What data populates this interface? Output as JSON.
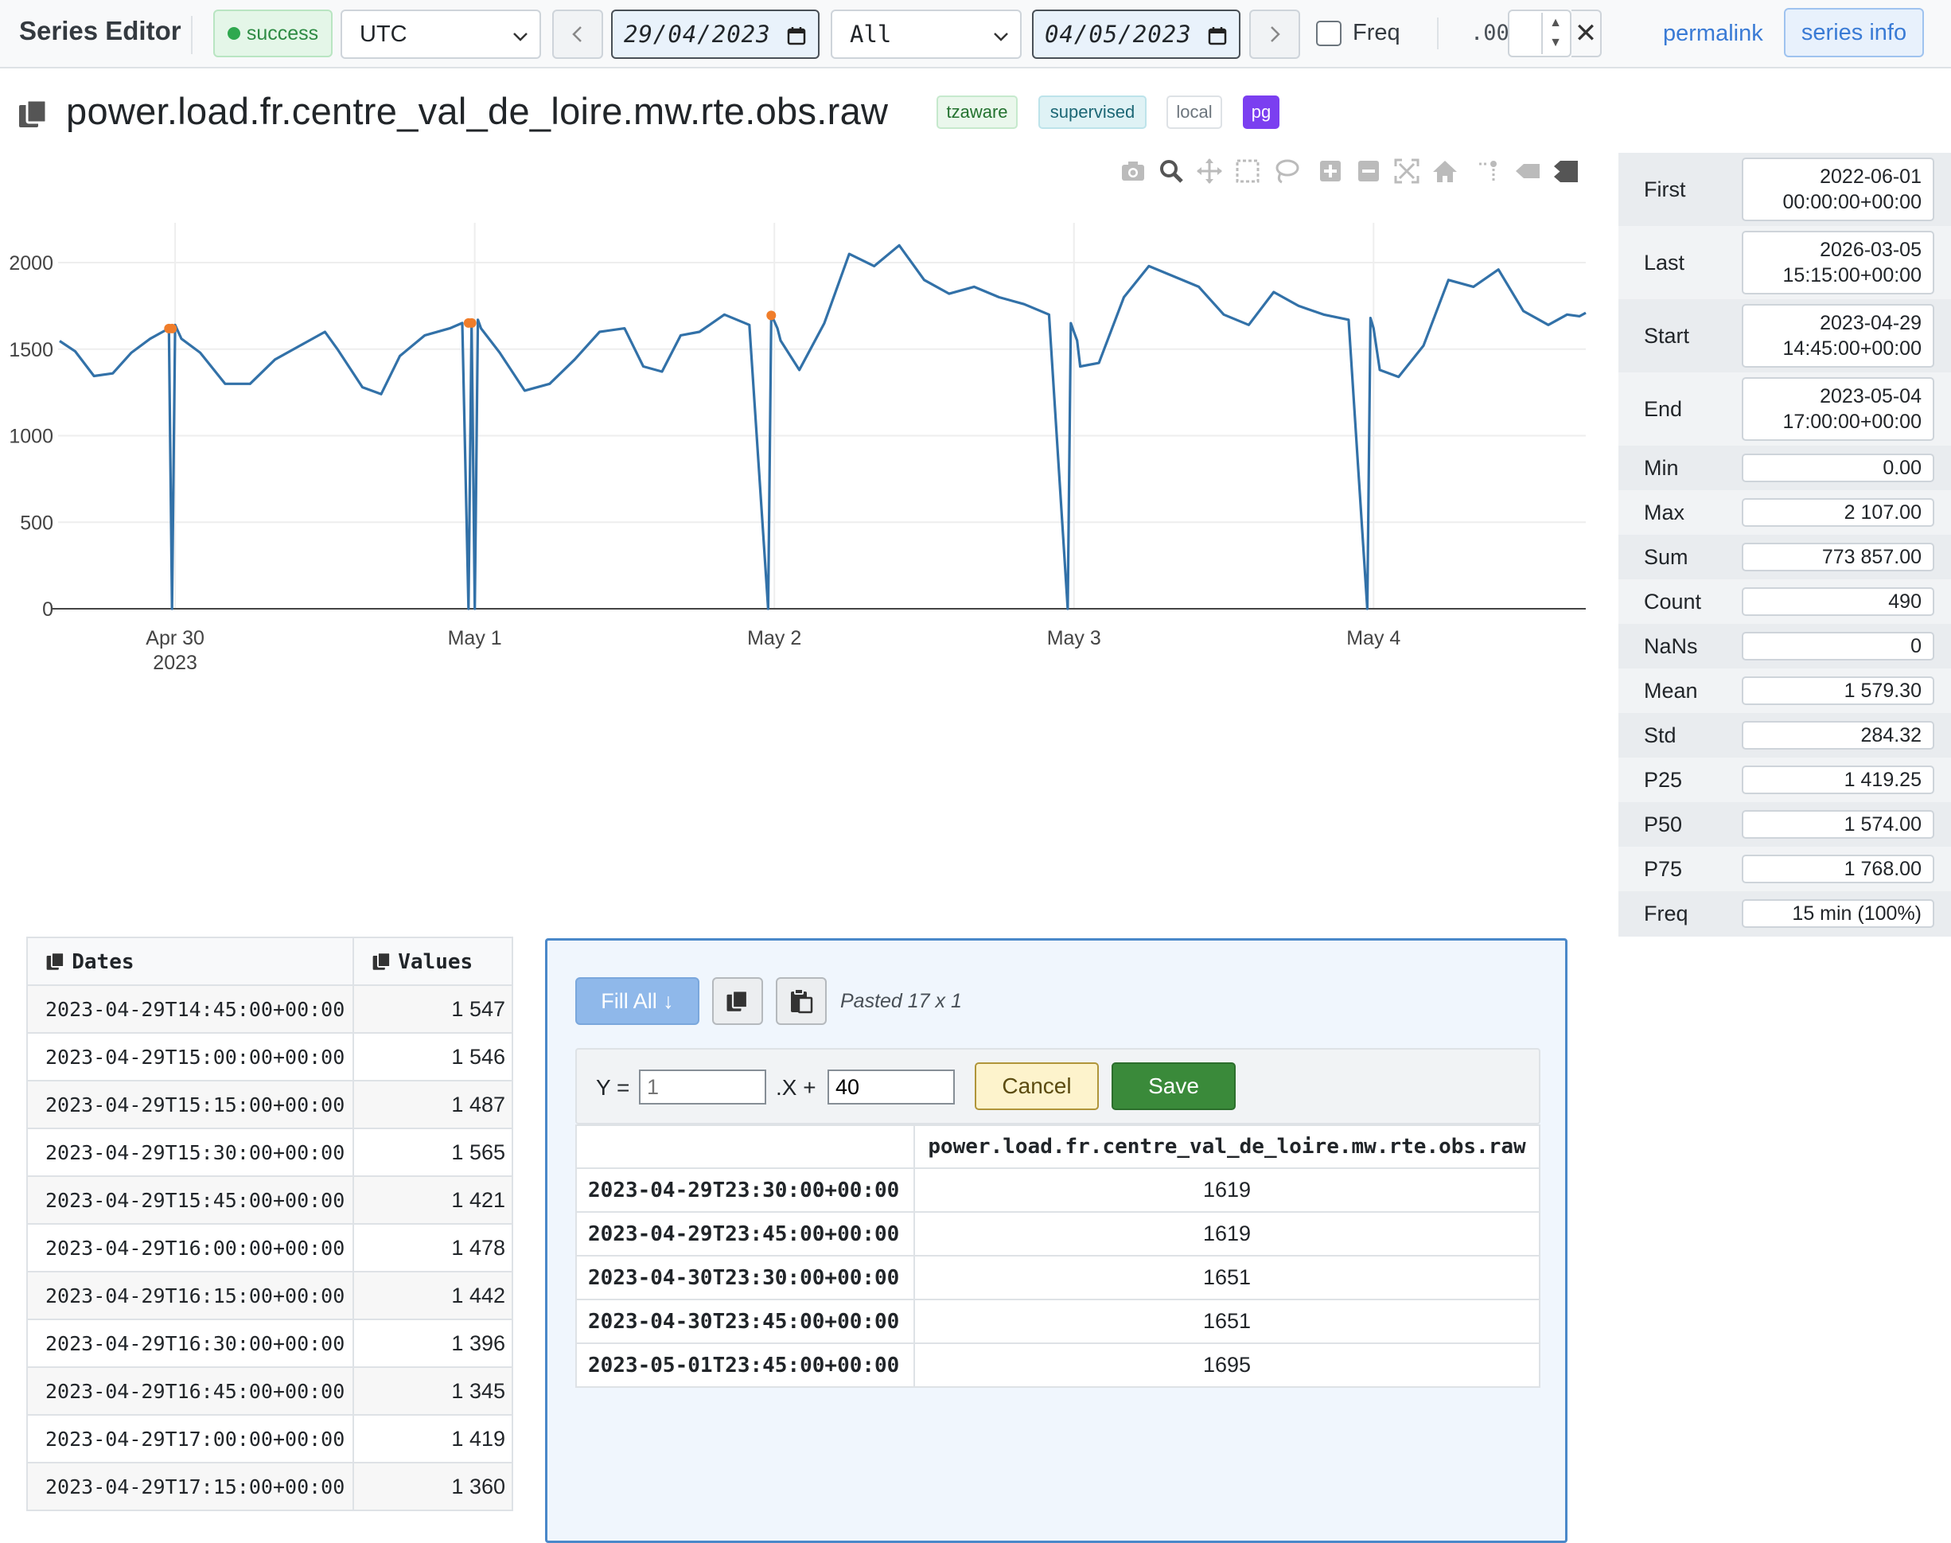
{
  "app": {
    "title": "Series Editor",
    "status": "success"
  },
  "toolbar": {
    "timezone": "UTC",
    "from_date": "29/04/2023",
    "mode": "All",
    "to_date": "04/05/2023",
    "freq_label": "Freq",
    "freq_checked": false,
    "decimals_label": ".00",
    "decimals_value": "",
    "permalink": "permalink",
    "series_info": "series info"
  },
  "series": {
    "name": "power.load.fr.centre_val_de_loire.mw.rte.obs.raw",
    "tags": [
      "tzaware",
      "supervised",
      "local",
      "pg"
    ]
  },
  "chart_data": {
    "type": "line",
    "x_tick_labels": [
      "Apr 30\n2023",
      "May 1",
      "May 2",
      "May 3",
      "May 4"
    ],
    "y_ticks": [
      0,
      500,
      1000,
      1500,
      2000
    ],
    "ylim": [
      0,
      2250
    ],
    "xlim": [
      "2023-04-29T14:45:00",
      "2023-05-04T17:00:00"
    ],
    "grid": true,
    "series": [
      {
        "color": "#3271a8",
        "x": [
          "2023-04-29T14:45",
          "2023-04-29T16:00",
          "2023-04-29T17:30",
          "2023-04-29T19:00",
          "2023-04-29T20:30",
          "2023-04-29T22:00",
          "2023-04-29T23:00",
          "2023-04-29T23:30",
          "2023-04-29T23:45",
          "2023-04-30T00:00",
          "2023-04-30T00:15",
          "2023-04-30T00:30",
          "2023-04-30T02:00",
          "2023-04-30T04:00",
          "2023-04-30T06:00",
          "2023-04-30T08:00",
          "2023-04-30T10:00",
          "2023-04-30T12:00",
          "2023-04-30T13:00",
          "2023-04-30T15:00",
          "2023-04-30T16:30",
          "2023-04-30T18:00",
          "2023-04-30T20:00",
          "2023-04-30T22:00",
          "2023-04-30T23:00",
          "2023-04-30T23:30",
          "2023-04-30T23:45",
          "2023-05-01T00:00",
          "2023-05-01T00:15",
          "2023-05-01T00:30",
          "2023-05-01T02:00",
          "2023-05-01T04:00",
          "2023-05-01T06:00",
          "2023-05-01T08:00",
          "2023-05-01T10:00",
          "2023-05-01T12:00",
          "2023-05-01T13:30",
          "2023-05-01T15:00",
          "2023-05-01T16:30",
          "2023-05-01T18:00",
          "2023-05-01T20:00",
          "2023-05-01T22:00",
          "2023-05-01T23:30",
          "2023-05-01T23:45",
          "2023-05-02T00:00",
          "2023-05-02T00:15",
          "2023-05-02T00:30",
          "2023-05-02T02:00",
          "2023-05-02T04:00",
          "2023-05-02T06:00",
          "2023-05-02T08:00",
          "2023-05-02T10:00",
          "2023-05-02T12:00",
          "2023-05-02T14:00",
          "2023-05-02T16:00",
          "2023-05-02T18:00",
          "2023-05-02T20:00",
          "2023-05-02T22:00",
          "2023-05-02T23:30",
          "2023-05-02T23:45",
          "2023-05-03T00:00",
          "2023-05-03T00:15",
          "2023-05-03T00:30",
          "2023-05-03T02:00",
          "2023-05-03T04:00",
          "2023-05-03T06:00",
          "2023-05-03T08:00",
          "2023-05-03T10:00",
          "2023-05-03T12:00",
          "2023-05-03T14:00",
          "2023-05-03T16:00",
          "2023-05-03T18:00",
          "2023-05-03T20:00",
          "2023-05-03T22:00",
          "2023-05-03T23:30",
          "2023-05-03T23:45",
          "2023-05-04T00:00",
          "2023-05-04T00:15",
          "2023-05-04T00:30",
          "2023-05-04T02:00",
          "2023-05-04T04:00",
          "2023-05-04T06:00",
          "2023-05-04T08:00",
          "2023-05-04T10:00",
          "2023-05-04T12:00",
          "2023-05-04T14:00",
          "2023-05-04T15:30",
          "2023-05-04T16:30",
          "2023-05-04T17:00"
        ],
        "y": [
          1547,
          1487,
          1345,
          1360,
          1480,
          1560,
          1600,
          1619,
          0,
          1640,
          1600,
          1560,
          1480,
          1300,
          1300,
          1440,
          1520,
          1600,
          1500,
          1280,
          1240,
          1460,
          1580,
          1620,
          1651,
          0,
          1660,
          0,
          1670,
          1620,
          1480,
          1260,
          1300,
          1440,
          1600,
          1620,
          1400,
          1370,
          1580,
          1600,
          1700,
          1640,
          0,
          1695,
          1660,
          1620,
          1550,
          1380,
          1650,
          2050,
          1980,
          2100,
          1900,
          1820,
          1860,
          1800,
          1760,
          1700,
          0,
          1650,
          1600,
          1550,
          1400,
          1420,
          1800,
          1980,
          1920,
          1860,
          1700,
          1640,
          1830,
          1750,
          1700,
          1670,
          0,
          1680,
          1620,
          1500,
          1380,
          1340,
          1520,
          1900,
          1860,
          1960,
          1720,
          1640,
          1700,
          1690,
          1710
        ]
      }
    ],
    "highlighted_points": [
      {
        "x": "2023-04-29T23:30",
        "y": 1619
      },
      {
        "x": "2023-04-29T23:45",
        "y": 1619
      },
      {
        "x": "2023-04-30T23:30",
        "y": 1651
      },
      {
        "x": "2023-04-30T23:45",
        "y": 1651
      },
      {
        "x": "2023-05-01T23:45",
        "y": 1695
      }
    ]
  },
  "stats": [
    {
      "label": "First",
      "value": "2022-06-01\n00:00:00+00:00"
    },
    {
      "label": "Last",
      "value": "2026-03-05\n15:15:00+00:00"
    },
    {
      "label": "Start",
      "value": "2023-04-29\n14:45:00+00:00"
    },
    {
      "label": "End",
      "value": "2023-05-04\n17:00:00+00:00"
    },
    {
      "label": "Min",
      "value": "0.00"
    },
    {
      "label": "Max",
      "value": "2 107.00"
    },
    {
      "label": "Sum",
      "value": "773 857.00"
    },
    {
      "label": "Count",
      "value": "490"
    },
    {
      "label": "NaNs",
      "value": "0"
    },
    {
      "label": "Mean",
      "value": "1 579.30"
    },
    {
      "label": "Std",
      "value": "284.32"
    },
    {
      "label": "P25",
      "value": "1 419.25"
    },
    {
      "label": "P50",
      "value": "1 574.00"
    },
    {
      "label": "P75",
      "value": "1 768.00"
    },
    {
      "label": "Freq",
      "value": "15 min (100%)"
    }
  ],
  "data_table": {
    "headers": [
      "Dates",
      "Values"
    ],
    "rows": [
      [
        "2023-04-29T14:45:00+00:00",
        "1 547"
      ],
      [
        "2023-04-29T15:00:00+00:00",
        "1 546"
      ],
      [
        "2023-04-29T15:15:00+00:00",
        "1 487"
      ],
      [
        "2023-04-29T15:30:00+00:00",
        "1 565"
      ],
      [
        "2023-04-29T15:45:00+00:00",
        "1 421"
      ],
      [
        "2023-04-29T16:00:00+00:00",
        "1 478"
      ],
      [
        "2023-04-29T16:15:00+00:00",
        "1 442"
      ],
      [
        "2023-04-29T16:30:00+00:00",
        "1 396"
      ],
      [
        "2023-04-29T16:45:00+00:00",
        "1 345"
      ],
      [
        "2023-04-29T17:00:00+00:00",
        "1 419"
      ],
      [
        "2023-04-29T17:15:00+00:00",
        "1 360"
      ]
    ]
  },
  "paste_panel": {
    "fill_all": "Fill All ↓",
    "pasted_note": "Pasted 17 x 1",
    "formula": {
      "y_label": "Y =",
      "a_placeholder": "1",
      "x_label": ".X +",
      "b_value": "40"
    },
    "cancel": "Cancel",
    "save": "Save",
    "column_header": "power.load.fr.centre_val_de_loire.mw.rte.obs.raw",
    "rows": [
      [
        "2023-04-29T23:30:00+00:00",
        "1619"
      ],
      [
        "2023-04-29T23:45:00+00:00",
        "1619"
      ],
      [
        "2023-04-30T23:30:00+00:00",
        "1651"
      ],
      [
        "2023-04-30T23:45:00+00:00",
        "1651"
      ],
      [
        "2023-05-01T23:45:00+00:00",
        "1695"
      ]
    ]
  }
}
